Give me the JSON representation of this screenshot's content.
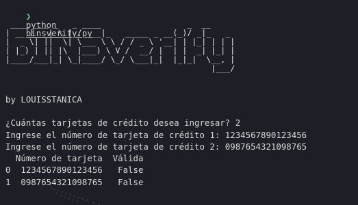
{
  "prompt": {
    "glyph": "❯",
    "command": "python",
    "file": "binsverify.py"
  },
  "banner": {
    "lines": [
      " ____ ___ _   _ ____                  _  __",
      "| __ )_ _| \\ | / ___|_   _____ _ __(_)/ _|_   _",
      "|  _ \\| ||  \\| \\___ \\ \\ / / _ \\ '__| | |_| | | |",
      "| |_) | || |\\  |___) \\ V /  __/ |  | |  _| |_| |",
      "|____/___|_| \\_|____/ \\_/ \\___|_|  |_|_|  \\__, |",
      "                                           |___/"
    ]
  },
  "author": "by LOUISSTANICA",
  "output": {
    "question": "¿Cuántas tarjetas de crédito desea ingresar? 2",
    "input1": "Ingrese el número de tarjeta de crédito 1: 1234567890123456",
    "input2": "Ingrese el número de tarjeta de crédito 2: 0987654321098765"
  },
  "table": {
    "header": "  Número de tarjeta  Válida",
    "rows": [
      "0  1234567890123456   False",
      "1  0987654321098765   False"
    ]
  },
  "colors": {
    "background": "#1e1f26",
    "text": "#d8d8d8",
    "prompt_accent": "#73c991"
  }
}
